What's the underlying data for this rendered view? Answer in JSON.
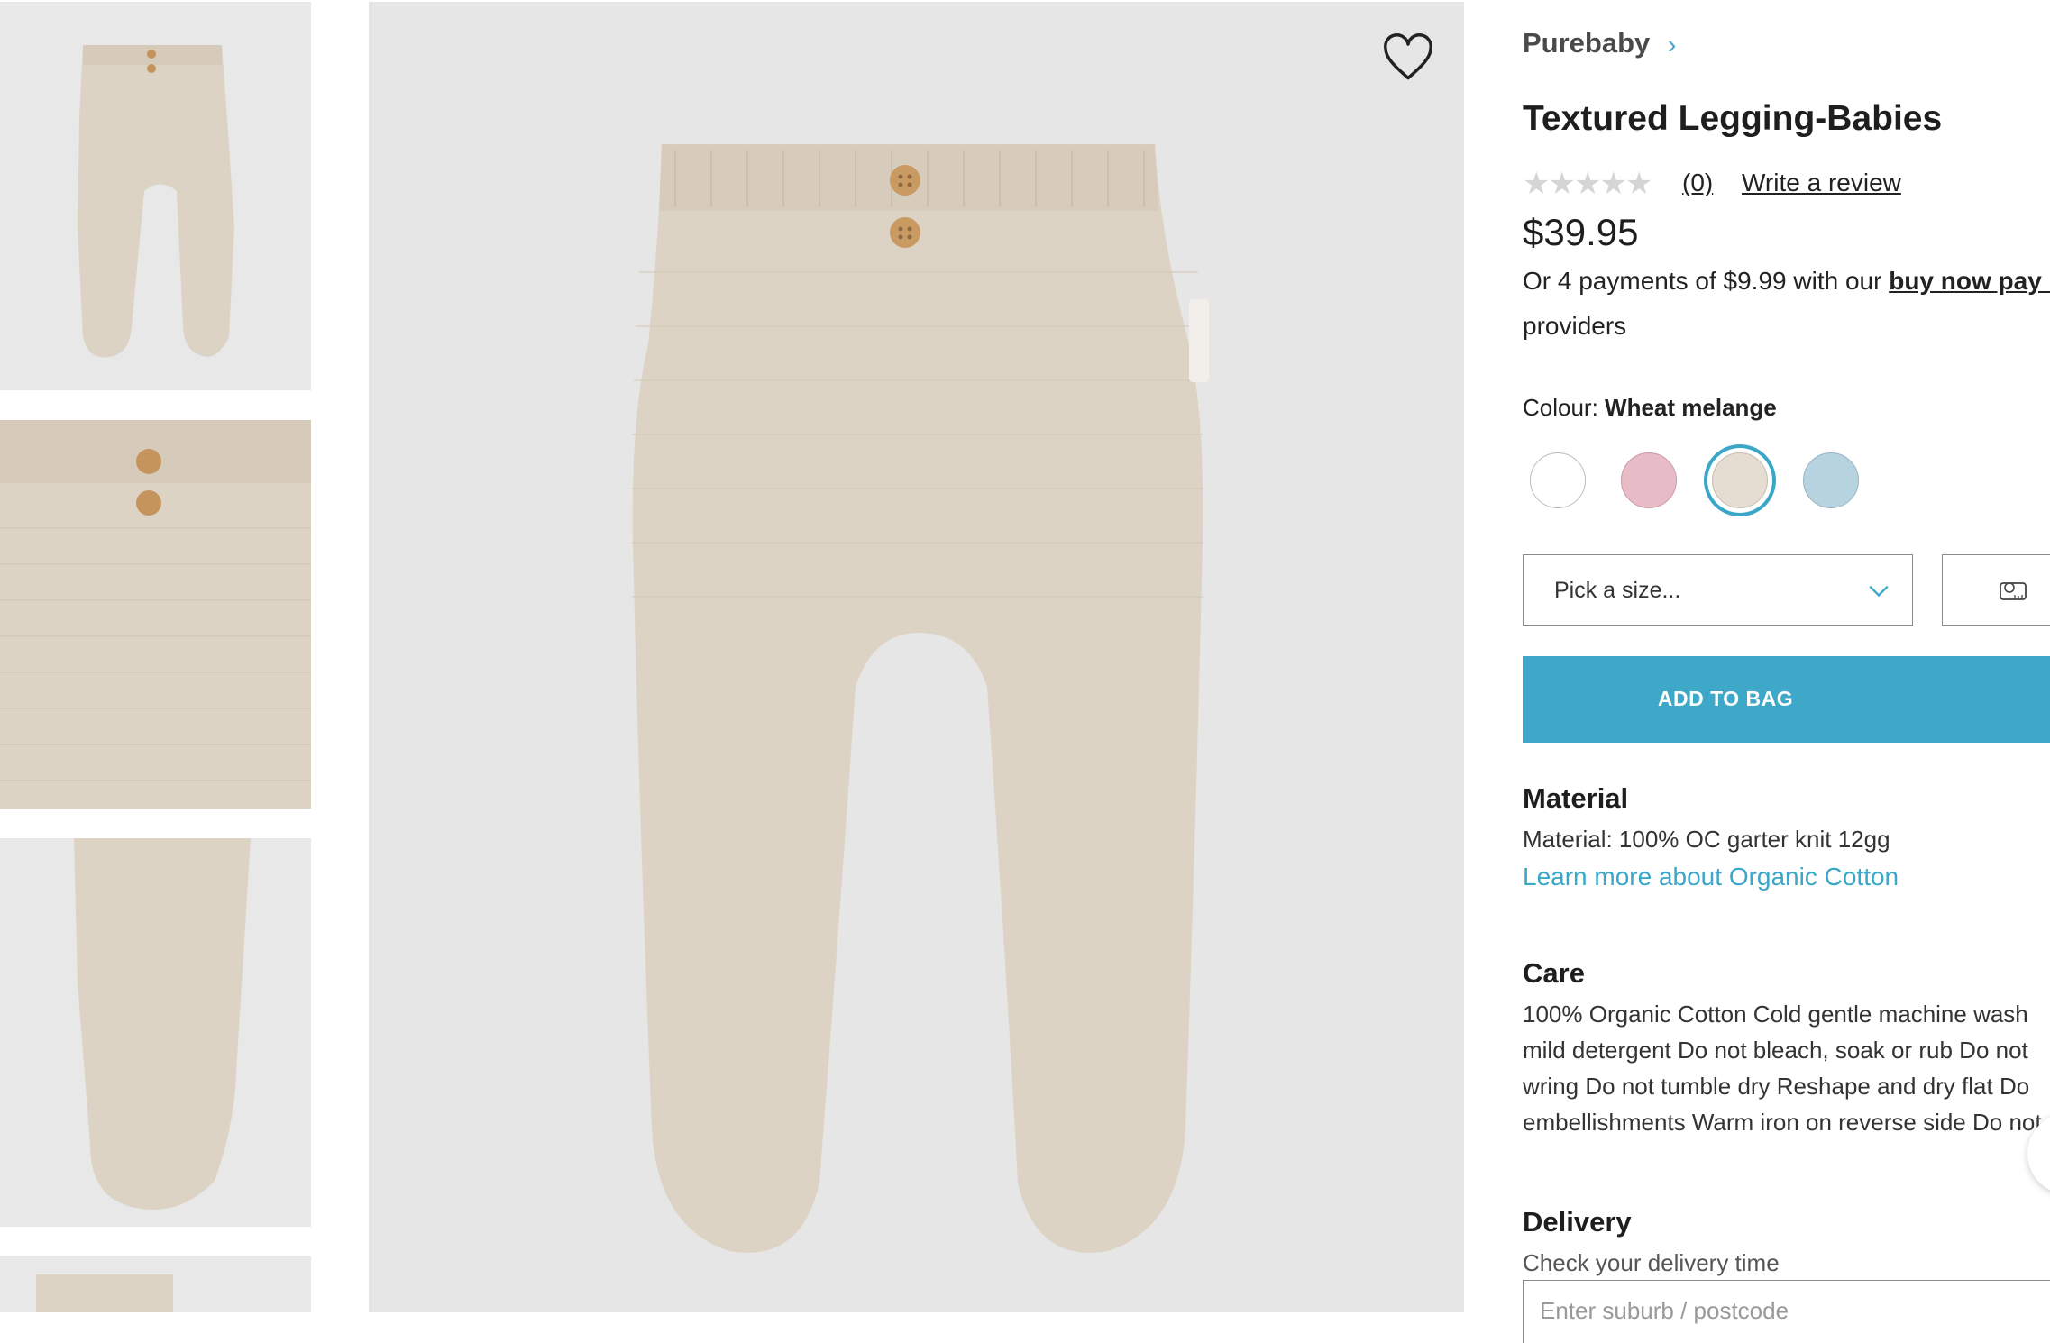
{
  "gallery": {
    "thumbnails": [
      {
        "name": "thumbnail-front-view"
      },
      {
        "name": "thumbnail-waistband-detail"
      },
      {
        "name": "thumbnail-foot-detail"
      },
      {
        "name": "thumbnail-fourth"
      }
    ],
    "wishlist_icon": "heart-outline-icon"
  },
  "product": {
    "brand": "Purebaby",
    "brand_chevron": "›",
    "title": "Textured Legging-Babies",
    "rating_stars": "★★★★★",
    "review_count": "(0)",
    "write_review": "Write a review",
    "price": "$39.95",
    "afterpay_prefix": "Or 4 payments of $9.99 with our ",
    "afterpay_link": "buy now pay later",
    "afterpay_suffix": "providers",
    "colour_label": "Colour: ",
    "colour_value": "Wheat melange",
    "swatches": [
      {
        "name": "White",
        "color": "#ffffff",
        "border": "#bdbdbd"
      },
      {
        "name": "Pink",
        "color": "#e7bcc6",
        "border": "#c79aa6"
      },
      {
        "name": "Wheat melange",
        "color": "#e6ddd2",
        "border": "#c8bcae",
        "selected": true
      },
      {
        "name": "Blue",
        "color": "#b8d3e0",
        "border": "#96b4c4"
      }
    ],
    "size_placeholder": "Pick a size...",
    "add_to_bag": "ADD TO BAG",
    "accent_color": "#3ea8c8"
  },
  "material": {
    "heading": "Material",
    "text": "Material: 100% OC garter knit 12gg",
    "link": "Learn more about Organic Cotton"
  },
  "care": {
    "heading": "Care",
    "lines": [
      "100% Organic Cotton Cold gentle machine wash",
      "mild detergent Do not bleach, soak or rub Do not",
      "wring Do not tumble dry Reshape and dry flat Do",
      "embellishments Warm iron on reverse side Do not"
    ]
  },
  "delivery": {
    "heading": "Delivery",
    "text": "Check your delivery time",
    "placeholder": "Enter suburb / postcode"
  }
}
